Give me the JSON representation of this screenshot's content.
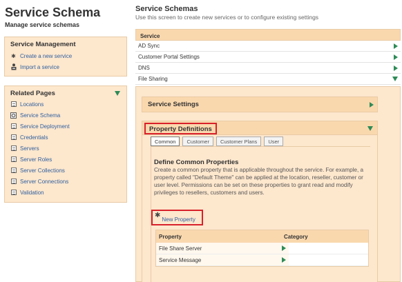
{
  "app": {
    "title": "Service Schema",
    "subtitle": "Manage service schemas"
  },
  "service_management": {
    "title": "Service Management",
    "links": [
      {
        "label": "Create a new service",
        "icon": "star-icon"
      },
      {
        "label": "Import a service",
        "icon": "import-icon"
      }
    ]
  },
  "related_pages": {
    "title": "Related Pages",
    "items": [
      {
        "label": "Locations"
      },
      {
        "label": "Service Schema"
      },
      {
        "label": "Service Deployment"
      },
      {
        "label": "Credentials"
      },
      {
        "label": "Servers"
      },
      {
        "label": "Server Roles"
      },
      {
        "label": "Server Collections"
      },
      {
        "label": "Server Connections"
      },
      {
        "label": "Validation"
      }
    ]
  },
  "main": {
    "title": "Service Schemas",
    "subtitle": "Use this screen to create new services or to configure existing settings",
    "service_table": {
      "header": "Service",
      "rows": [
        {
          "label": "AD Sync"
        },
        {
          "label": "Customer Portal Settings"
        },
        {
          "label": "DNS"
        },
        {
          "label": "File Sharing"
        }
      ]
    },
    "service_settings": {
      "label": "Service Settings"
    },
    "property_definitions": {
      "label": "Property Definitions",
      "tabs": [
        "Common",
        "Customer",
        "Customer Plans",
        "User"
      ],
      "active_tab": "Common",
      "content_title": "Define Common Properties",
      "content_desc": "Create a common property that is applicable throughout the service. For example, a property called \"Default Theme\" can be applied at the location, reseller, customer or user level. Permissions can be set on these properties to grant read and modify privileges to resellers, customers and users.",
      "new_property_label": "New Property",
      "table": {
        "col_property": "Property",
        "col_category": "Category",
        "rows": [
          {
            "property": "File Share Server",
            "category": ""
          },
          {
            "property": "Service Message",
            "category": ""
          }
        ]
      }
    }
  },
  "colors": {
    "panel_bg": "#fde7cd",
    "header_bg": "#fad8ae",
    "link": "#2f5f9e",
    "arrow_green": "#2e8b57",
    "highlight_red": "#d81f2a"
  }
}
